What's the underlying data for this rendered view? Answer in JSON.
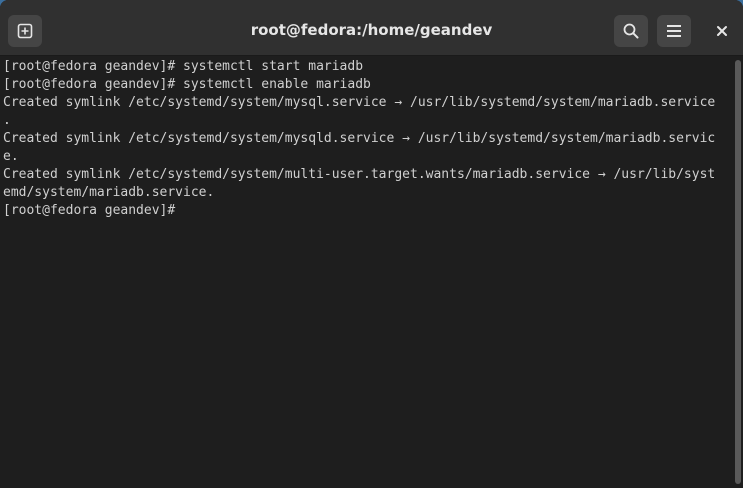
{
  "window": {
    "title": "root@fedora:/home/geandev"
  },
  "toolbar": {
    "new_tab_icon": "new-tab-icon",
    "search_icon": "search-icon",
    "menu_icon": "hamburger-menu-icon",
    "close_label": "×"
  },
  "terminal": {
    "lines": [
      "[root@fedora geandev]# systemctl start mariadb",
      "[root@fedora geandev]# systemctl enable mariadb",
      "Created symlink /etc/systemd/system/mysql.service → /usr/lib/systemd/system/mariadb.service",
      ".",
      "Created symlink /etc/systemd/system/mysqld.service → /usr/lib/systemd/system/mariadb.servic",
      "e.",
      "Created symlink /etc/systemd/system/multi-user.target.wants/mariadb.service → /usr/lib/syst",
      "emd/system/mariadb.service.",
      "[root@fedora geandev]# "
    ]
  },
  "colors": {
    "background": "#1e1e1e",
    "foreground": "#d0d0d0",
    "titlebar": "#303030",
    "button": "#454545"
  }
}
